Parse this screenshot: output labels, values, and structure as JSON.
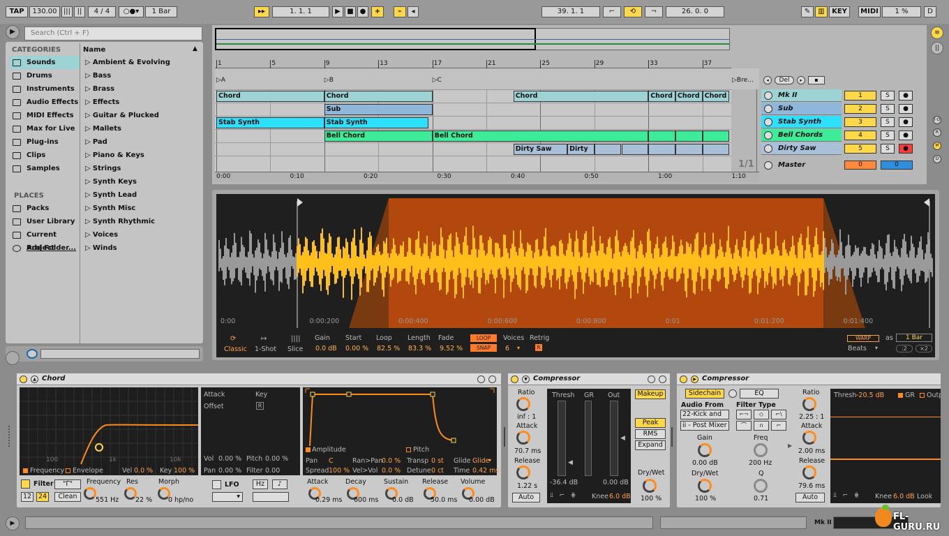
{
  "transport": {
    "tap": "TAP",
    "tempo": "130.00",
    "signature_num": "4",
    "signature_den": "4",
    "quantize": "1 Bar",
    "position": "1.   1.   1",
    "loop_start": "39.  1.  1",
    "loop_length": "26.  0.  0",
    "key": "KEY",
    "midi": "MIDI",
    "cpu": "1 %",
    "d": "D"
  },
  "browser": {
    "search_placeholder": "Search (Ctrl + F)",
    "categories_header": "CATEGORIES",
    "categories": [
      "Sounds",
      "Drums",
      "Instruments",
      "Audio Effects",
      "MIDI Effects",
      "Max for Live",
      "Plug-ins",
      "Clips",
      "Samples"
    ],
    "places_header": "PLACES",
    "places": [
      "Packs",
      "User Library",
      "Current Project",
      "Add Folder..."
    ],
    "name_header": "Name",
    "items": [
      "Ambient & Evolving",
      "Bass",
      "Brass",
      "Effects",
      "Guitar & Plucked",
      "Mallets",
      "Pad",
      "Piano & Keys",
      "Strings",
      "Synth Keys",
      "Synth Lead",
      "Synth Misc",
      "Synth Rhythmic",
      "Voices",
      "Winds"
    ]
  },
  "arrangement": {
    "bar_labels": [
      "1",
      "5",
      "9",
      "13",
      "17",
      "21",
      "25",
      "29",
      "33",
      "37"
    ],
    "locators": [
      "A",
      "B",
      "C",
      "Bre..."
    ],
    "time_labels": [
      "0:00",
      "0:10",
      "0:20",
      "0:30",
      "0:40",
      "0:50",
      "1:00",
      "1:10"
    ],
    "clips": {
      "chord": "Chord",
      "sub": "Sub",
      "stab": "Stab Synth",
      "bell": "Bell Chord",
      "dirty1": "Dirty Saw",
      "dirty2": "Dirty"
    },
    "del": "Del",
    "counter": "1/1",
    "tracks": [
      {
        "name": "Mk II",
        "num": "1",
        "color": "#9ed3d6"
      },
      {
        "name": "Sub",
        "num": "2",
        "color": "#8fb7d9"
      },
      {
        "name": "Stab Synth",
        "num": "3",
        "color": "#2ee0ff"
      },
      {
        "name": "Bell Chords",
        "num": "4",
        "color": "#3deb99"
      },
      {
        "name": "Dirty Saw",
        "num": "5",
        "color": "#a8c0d8"
      }
    ],
    "master": {
      "name": "Master",
      "vol": "0",
      "pan": "0"
    },
    "solo": "S"
  },
  "sample": {
    "time_labels": [
      "0:00",
      "0:00:200",
      "0:00:400",
      "0:00:600",
      "0:00:800",
      "0:01",
      "0:01:200",
      "0:01:400"
    ],
    "modes": {
      "classic": "Classic",
      "oneshot": "1-Shot",
      "slice": "Slice"
    },
    "gain": {
      "label": "Gain",
      "value": "0.0 dB"
    },
    "start": {
      "label": "Start",
      "value": "0.00 %"
    },
    "loop": {
      "label": "Loop",
      "value": "82.5 %"
    },
    "length": {
      "label": "Length",
      "value": "83.3 %"
    },
    "fade": {
      "label": "Fade",
      "value": "9.52 %"
    },
    "loop_btn": "LOOP",
    "snap_btn": "SNAP",
    "voices": {
      "label": "Voices",
      "value": "6"
    },
    "retrig": {
      "label": "Retrig",
      "value": "R"
    },
    "warp": "WARP",
    "as": "as",
    "bar": "1 Bar",
    "beats": "Beats",
    "div": ":2",
    "mul": "×2"
  },
  "chord_device": {
    "title": "Chord",
    "filter_labels": [
      "100",
      "1k",
      "10k"
    ],
    "freq_tab": "Frequency",
    "env_tab": "Envelope",
    "vel": {
      "label": "Vel",
      "value": "0.0 %"
    },
    "key": {
      "label": "Key",
      "value": "100 %"
    },
    "filter": "Filter",
    "filter_type": "\"Γ\"",
    "slope12": "12",
    "slope24": "24",
    "clean": "Clean",
    "frequency": {
      "label": "Frequency",
      "value": "551 Hz"
    },
    "res": {
      "label": "Res",
      "value": "22 %"
    },
    "morph": {
      "label": "Morph",
      "value": "0 hp/no"
    },
    "lfo": {
      "attack": "Attack",
      "key": "Key",
      "offset": "Offset",
      "r": "R",
      "vol": "Vol",
      "vol_v": "0.00 %",
      "pitch": "Pitch",
      "pitch_v": "0.00 %",
      "pan": "Pan",
      "pan_v": "0.00 %",
      "filter": "Filter",
      "filter_v": "0.00"
    },
    "lfo_btn": "LFO",
    "hz": "Hz",
    "note": "♪",
    "amp": {
      "amplitude": "Amplitude",
      "pitch": "Pitch",
      "pan": "Pan",
      "pan_v": "C",
      "ranpan": "Ran>Pan",
      "ranpan_v": "0.0 %",
      "transp": "Transp",
      "transp_v": "0 st",
      "glide": "Glide",
      "glide_v": "Glide",
      "spread": "Spread",
      "spread_v": "100 %",
      "velvol": "Vel>Vol",
      "velvol_v": "0.0 %",
      "detune": "Detune",
      "detune_v": "0 ct",
      "time": "Time",
      "time_v": "0.42 ms"
    },
    "env": {
      "attack": "Attack",
      "attack_v": "0.29 ms",
      "decay": "Decay",
      "decay_v": "600 ms",
      "sustain": "Sustain",
      "sustain_v": "0.0 dB",
      "release": "Release",
      "release_v": "50.0 ms",
      "volume": "Volume",
      "volume_v": "0.00 dB"
    }
  },
  "comp1": {
    "title": "Compressor",
    "ratio": {
      "label": "Ratio",
      "value": "inf : 1"
    },
    "attack": {
      "label": "Attack",
      "value": "70.7 ms"
    },
    "release": {
      "label": "Release",
      "value": "1.22 s"
    },
    "auto": "Auto",
    "thresh": "Thresh",
    "gr": "GR",
    "out": "Out",
    "thresh_v": "-36.4 dB",
    "out_v": "0.00 dB",
    "knee": "Knee",
    "knee_v": "6.0 dB",
    "makeup": "Makeup",
    "peak": "Peak",
    "rms": "RMS",
    "expand": "Expand",
    "drywet": {
      "label": "Dry/Wet",
      "value": "100 %"
    }
  },
  "comp2": {
    "title": "Compressor",
    "sidechain": "Sidechain",
    "eq": "EQ",
    "audio_from": "Audio From",
    "source": "22-Kick and",
    "post": "ii - Post Mixer",
    "filter_type": "Filter Type",
    "gain": {
      "label": "Gain",
      "value": "0.00 dB"
    },
    "freq": {
      "label": "Freq",
      "value": "200 Hz"
    },
    "drywet": {
      "label": "Dry/Wet",
      "value": "100 %"
    },
    "q": {
      "label": "Q",
      "value": "0.71"
    },
    "ratio": {
      "label": "Ratio",
      "value": "2.25 : 1"
    },
    "attack": {
      "label": "Attack",
      "value": "2.00 ms"
    },
    "release": {
      "label": "Release",
      "value": "79.6 ms"
    },
    "auto": "Auto",
    "thresh": "Thresh",
    "thresh_v": "-20.5 dB",
    "gr": "GR",
    "output": "Outp",
    "knee": "Knee",
    "knee_v": "6.0 dB",
    "look": "Look"
  },
  "status": {
    "track": "Mk II"
  },
  "watermark": "FL-GURU.RU"
}
